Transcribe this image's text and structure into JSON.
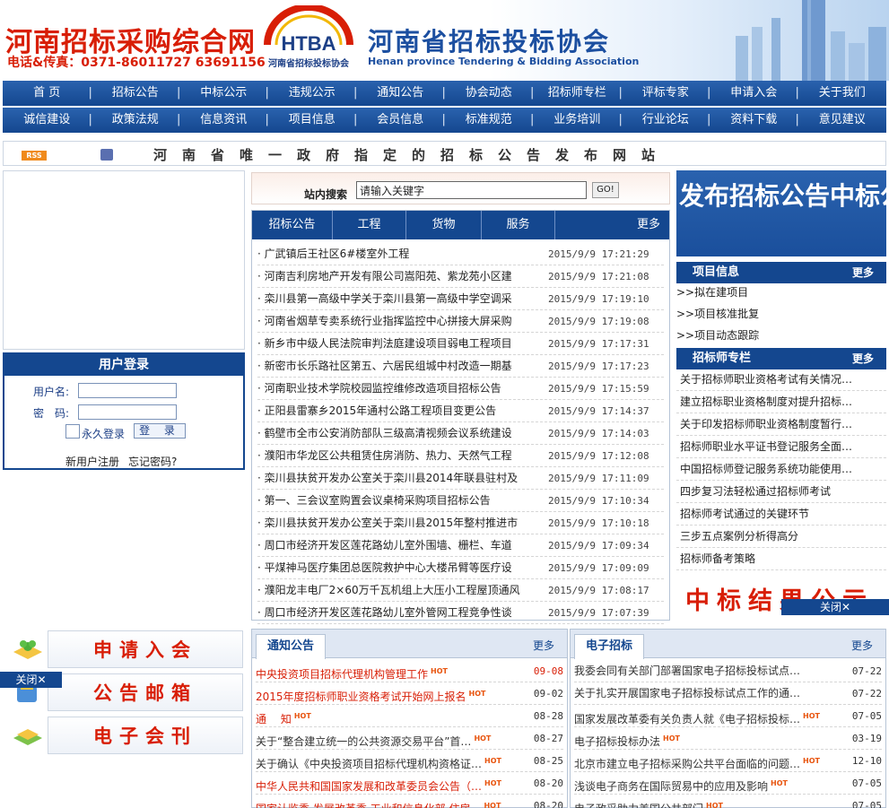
{
  "header": {
    "site_title": "河南招标采购综合网",
    "phone": "电话&传真：0371-86011727 63691156",
    "logo_text": "HTBA",
    "logo_sub": "河南省招标投标协会",
    "assoc_cn": "河南省招标投标协会",
    "assoc_en": "Henan province Tendering & Bidding Association"
  },
  "nav1": [
    "首  页",
    "招标公告",
    "中标公示",
    "违规公示",
    "通知公告",
    "协会动态",
    "招标师专栏",
    "评标专家",
    "申请入会",
    "关于我们"
  ],
  "nav2": [
    "诚信建设",
    "政策法规",
    "信息资讯",
    "项目信息",
    "会员信息",
    "标准规范",
    "业务培训",
    "行业论坛",
    "资料下载",
    "意见建议"
  ],
  "notice": {
    "rss": "RSS",
    "text": "河南省唯一政府指定的招标公告发布网站"
  },
  "login": {
    "title": "用户登录",
    "username_label": "用户名:",
    "password_label": "密　码:",
    "remember": "永久登录",
    "submit": "登 录",
    "register": "新用户注册",
    "forgot": "忘记密码?"
  },
  "search": {
    "label": "站内搜索",
    "value": "请输入关键字",
    "go": "GO!"
  },
  "bid_tabs": [
    "招标公告",
    "工程",
    "货物",
    "服务",
    "更多"
  ],
  "bid_list": [
    {
      "title": "广武镇后王社区6#楼室外工程",
      "date": "2015/9/9 17:21:29"
    },
    {
      "title": "河南吉利房地产开发有限公司嵩阳苑、紫龙苑小区建",
      "date": "2015/9/9 17:21:08"
    },
    {
      "title": "栾川县第一高级中学关于栾川县第一高级中学空调采",
      "date": "2015/9/9 17:19:10"
    },
    {
      "title": "河南省烟草专卖系统行业指挥监控中心拼接大屏采购",
      "date": "2015/9/9 17:19:08"
    },
    {
      "title": "新乡市中级人民法院审判法庭建设项目弱电工程项目",
      "date": "2015/9/9 17:17:31"
    },
    {
      "title": "新密市长乐路社区第五、六居民组城中村改造一期基",
      "date": "2015/9/9 17:17:23"
    },
    {
      "title": "河南职业技术学院校园监控维修改造项目招标公告",
      "date": "2015/9/9 17:15:59"
    },
    {
      "title": "正阳县雷寨乡2015年通村公路工程项目变更公告",
      "date": "2015/9/9 17:14:37"
    },
    {
      "title": "鹤壁市全市公安消防部队三级高清视频会议系统建设",
      "date": "2015/9/9 17:14:03"
    },
    {
      "title": "濮阳市华龙区公共租赁住房消防、热力、天然气工程",
      "date": "2015/9/9 17:12:08"
    },
    {
      "title": "栾川县扶贫开发办公室关于栾川县2014年联县驻村及",
      "date": "2015/9/9 17:11:09"
    },
    {
      "title": "第一、三会议室购置会议桌椅采购项目招标公告",
      "date": "2015/9/9 17:10:34"
    },
    {
      "title": "栾川县扶贫开发办公室关于栾川县2015年整村推进市",
      "date": "2015/9/9 17:10:18"
    },
    {
      "title": "周口市经济开发区莲花路幼儿室外围墙、栅栏、车道",
      "date": "2015/9/9 17:09:34"
    },
    {
      "title": "平煤神马医疗集团总医院救护中心大楼吊臂等医疗设",
      "date": "2015/9/9 17:09:09"
    },
    {
      "title": "濮阳龙丰电厂2×60万千瓦机组上大压小工程屋顶通风",
      "date": "2015/9/9 17:08:17"
    },
    {
      "title": "周口市经济开发区莲花路幼儿室外管网工程竞争性谈",
      "date": "2015/9/9 17:07:39"
    }
  ],
  "promo": "发布招标公告中标公示由此进入",
  "project_info": {
    "title": "项目信息",
    "more": "更多",
    "items": [
      "拟在建项目",
      "项目核准批复",
      "项目动态跟踪"
    ]
  },
  "column": {
    "title": "招标师专栏",
    "more": "更多",
    "items": [
      "关于招标师职业资格考试有关情况…",
      "建立招标职业资格制度对提升招标…",
      "关于印发招标师职业资格制度暂行…",
      "招标师职业水平证书登记服务全面…",
      "中国招标师登记服务系统功能使用…",
      "四步复习法轻松通过招标师考试",
      "招标师考试通过的关键环节",
      "三步五点案例分析得高分",
      "招标师备考策略"
    ]
  },
  "winner_banner": "中标结果公示",
  "close": "关闭",
  "quick_links": [
    "申请入会",
    "公告邮箱",
    "电子会刊"
  ],
  "notice_panel": {
    "title": "通知公告",
    "more": "更多",
    "hot": "HOT",
    "items": [
      {
        "title": "中央投资项目招标代理机构管理工作",
        "date": "09-08",
        "red": true
      },
      {
        "title": "2015年度招标师职业资格考试开始网上报名",
        "date": "09-02",
        "red": true
      },
      {
        "title": "通　 知",
        "date": "08-28",
        "red": true
      },
      {
        "title": "关于“整合建立统一的公共资源交易平台”首…",
        "date": "08-27",
        "red": false
      },
      {
        "title": "关于确认《中央投资项目招标代理机构资格证…",
        "date": "08-25",
        "red": false
      },
      {
        "title": "中华人民共和国国家发展和改革委员会公告（…",
        "date": "08-20",
        "red": true
      },
      {
        "title": "国家认监委 发展改革委 工业和信息化部 住房…",
        "date": "08-20",
        "red": true
      }
    ]
  },
  "ebid_panel": {
    "title": "电子招标",
    "more": "更多",
    "hot": "HOT",
    "items": [
      {
        "title": "我委会同有关部门部署国家电子招标投标试点…",
        "date": "07-22",
        "hot": false
      },
      {
        "title": "关于扎实开展国家电子招标投标试点工作的通…",
        "date": "07-22",
        "hot": false
      },
      {
        "title": "国家发展改革委有关负责人就《电子招标投标…",
        "date": "07-05",
        "hot": true
      },
      {
        "title": "电子招标投标办法",
        "date": "03-19",
        "hot": true
      },
      {
        "title": "北京市建立电子招标采购公共平台面临的问题…",
        "date": "12-10",
        "hot": true
      },
      {
        "title": "浅谈电子商务在国际贸易中的应用及影响",
        "date": "07-05",
        "hot": true
      },
      {
        "title": "电子政采助力美国公共部门",
        "date": "07-05",
        "hot": true
      }
    ]
  }
}
